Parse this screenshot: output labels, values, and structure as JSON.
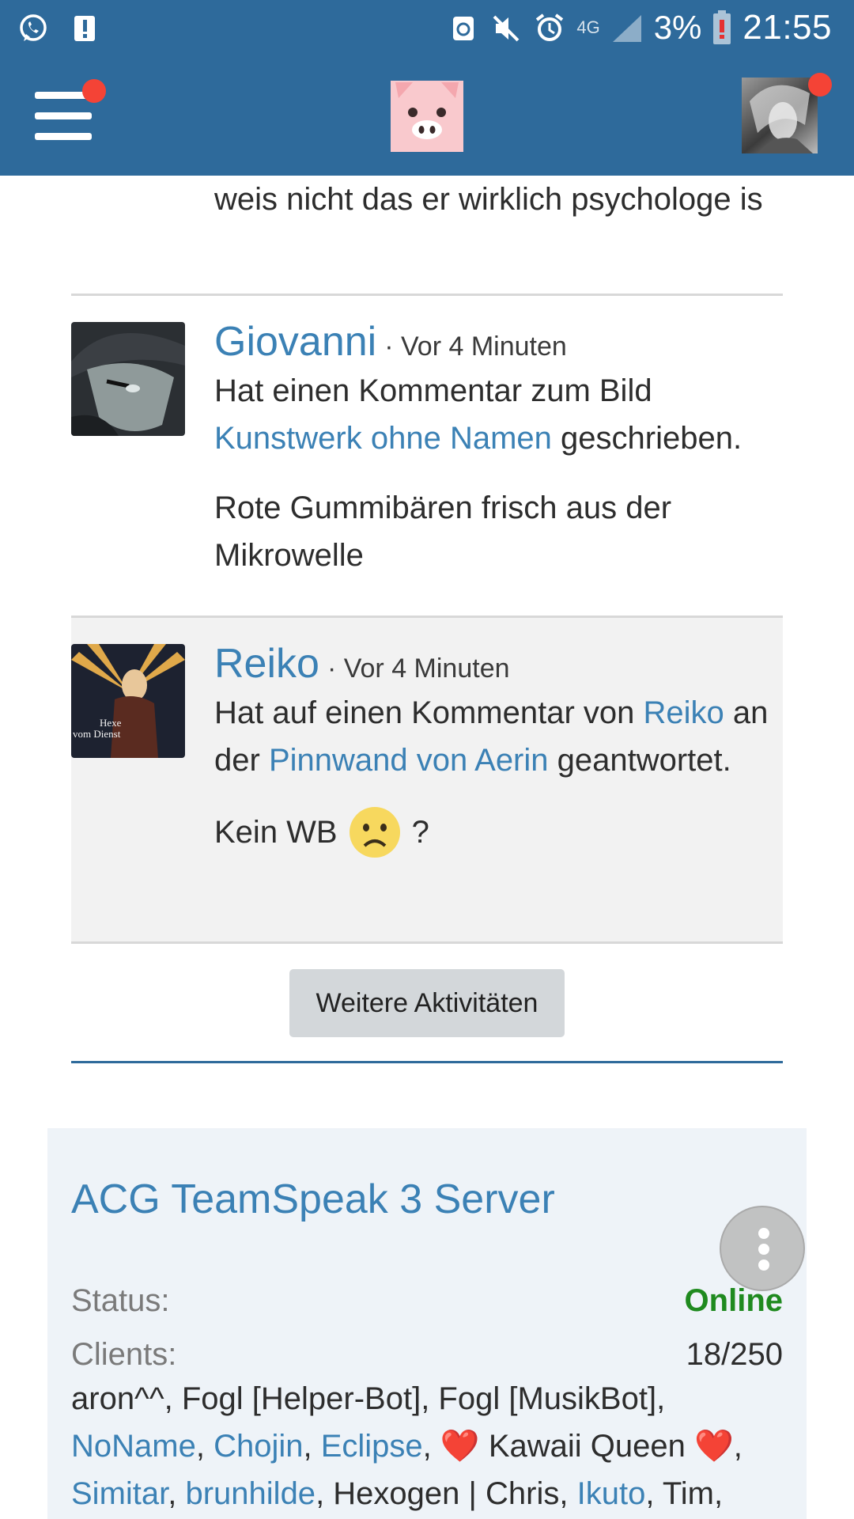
{
  "status_bar": {
    "battery": "3%",
    "time": "21:55",
    "network": "4G",
    "icons": [
      "whatsapp-icon",
      "alert-icon",
      "recycle-icon",
      "mute-icon",
      "alarm-icon",
      "signal-icon",
      "battery-icon"
    ]
  },
  "header": {
    "menu_icon": "hamburger-menu-icon",
    "logo_icon": "pig-logo-icon",
    "notification_color": "#f44336",
    "bar_color": "#2e6a9b"
  },
  "activities": {
    "tail_text": "weis nicht das er wirklich psychologe is",
    "entries": [
      {
        "user": "Giovanni",
        "time": "· Vor 4 Minuten",
        "text_before": "Hat einen Kommentar zum Bild ",
        "link1": "Kunstwerk ohne Namen",
        "text_after": " geschrieben.",
        "quote": "Rote Gummibären frisch aus der Mikrowelle"
      },
      {
        "user": "Reiko",
        "time": "· Vor 4 Minuten",
        "text_before": "Hat auf einen Kommentar von ",
        "link1": "Reiko",
        "text_mid": " an der ",
        "link2": "Pinnwand von Aerin",
        "text_after": " geantwortet.",
        "quote": "Kein WB",
        "quote_end": "?",
        "avatar_caption": "Hexe vom Dienst"
      }
    ],
    "more_button": "Weitere Aktivitäten"
  },
  "teamspeak": {
    "title": "ACG TeamSpeak 3 Server",
    "status_label": "Status:",
    "status_value": "Online",
    "clients_label": "Clients:",
    "clients_value": "18/250",
    "clients_list": [
      {
        "name": "aron^^",
        "link": false
      },
      {
        "name": "Fogl [Helper-Bot]",
        "link": false
      },
      {
        "name": "Fogl [MusikBot]",
        "link": false
      },
      {
        "name": "NoName",
        "link": true
      },
      {
        "name": "Chojin",
        "link": true
      },
      {
        "name": "Eclipse",
        "link": true
      },
      {
        "name": "Kawaii Queen",
        "link": false,
        "hearts": true
      },
      {
        "name": "Simitar",
        "link": true
      },
      {
        "name": "brunhilde",
        "link": true
      },
      {
        "name": "Hexogen | Chris",
        "link": false
      },
      {
        "name": "Ikuto",
        "link": true
      },
      {
        "name": "Tim",
        "link": false
      }
    ]
  },
  "fab": {
    "icon": "more-vertical-icon"
  }
}
